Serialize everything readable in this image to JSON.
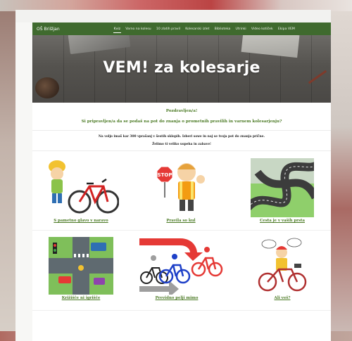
{
  "site": {
    "brand": "OŠ Brišljan",
    "nav": [
      "Kviz",
      "Varno na kolesu",
      "10 zlatih pravil",
      "Kolesarski izlet",
      "Biblioteka",
      "Utrinki",
      "Video kotiček",
      "Ekipa VEM"
    ],
    "active_nav": "Kviz"
  },
  "hero": {
    "title": "VEM! za kolesarje"
  },
  "greeting": {
    "line1": "Pozdravljen/a!",
    "line2": "Si pripravljen/a da se podaš na pot do znanja o prometnih pravilih in varnem kolesarjenju?"
  },
  "intro": {
    "line1": "Na voljo imaš kar 300 vprašanj v šestih sklopih. Izberi sowe in naj se tvoja pot do znanja prične.",
    "line2": "Želimo ti veliko uspeha in zabave!"
  },
  "cards": [
    {
      "label": "S pametno glavo v naravo",
      "icon": "cyclist-helmet-bike-icon"
    },
    {
      "label": "Pravila so kul",
      "icon": "stop-sign-kid-icon"
    },
    {
      "label": "Cesta je v vaših prsta",
      "icon": "road-knot-icon"
    },
    {
      "label": "Križišče ni igrišče",
      "icon": "intersection-icon"
    },
    {
      "label": "Previdno pelji mimo",
      "icon": "overtaking-cyclists-icon"
    },
    {
      "label": "Ali veš?",
      "icon": "cartoon-cyclist-icon"
    }
  ],
  "colors": {
    "nav": "#3f6a2e",
    "accent": "#4b7a24"
  }
}
